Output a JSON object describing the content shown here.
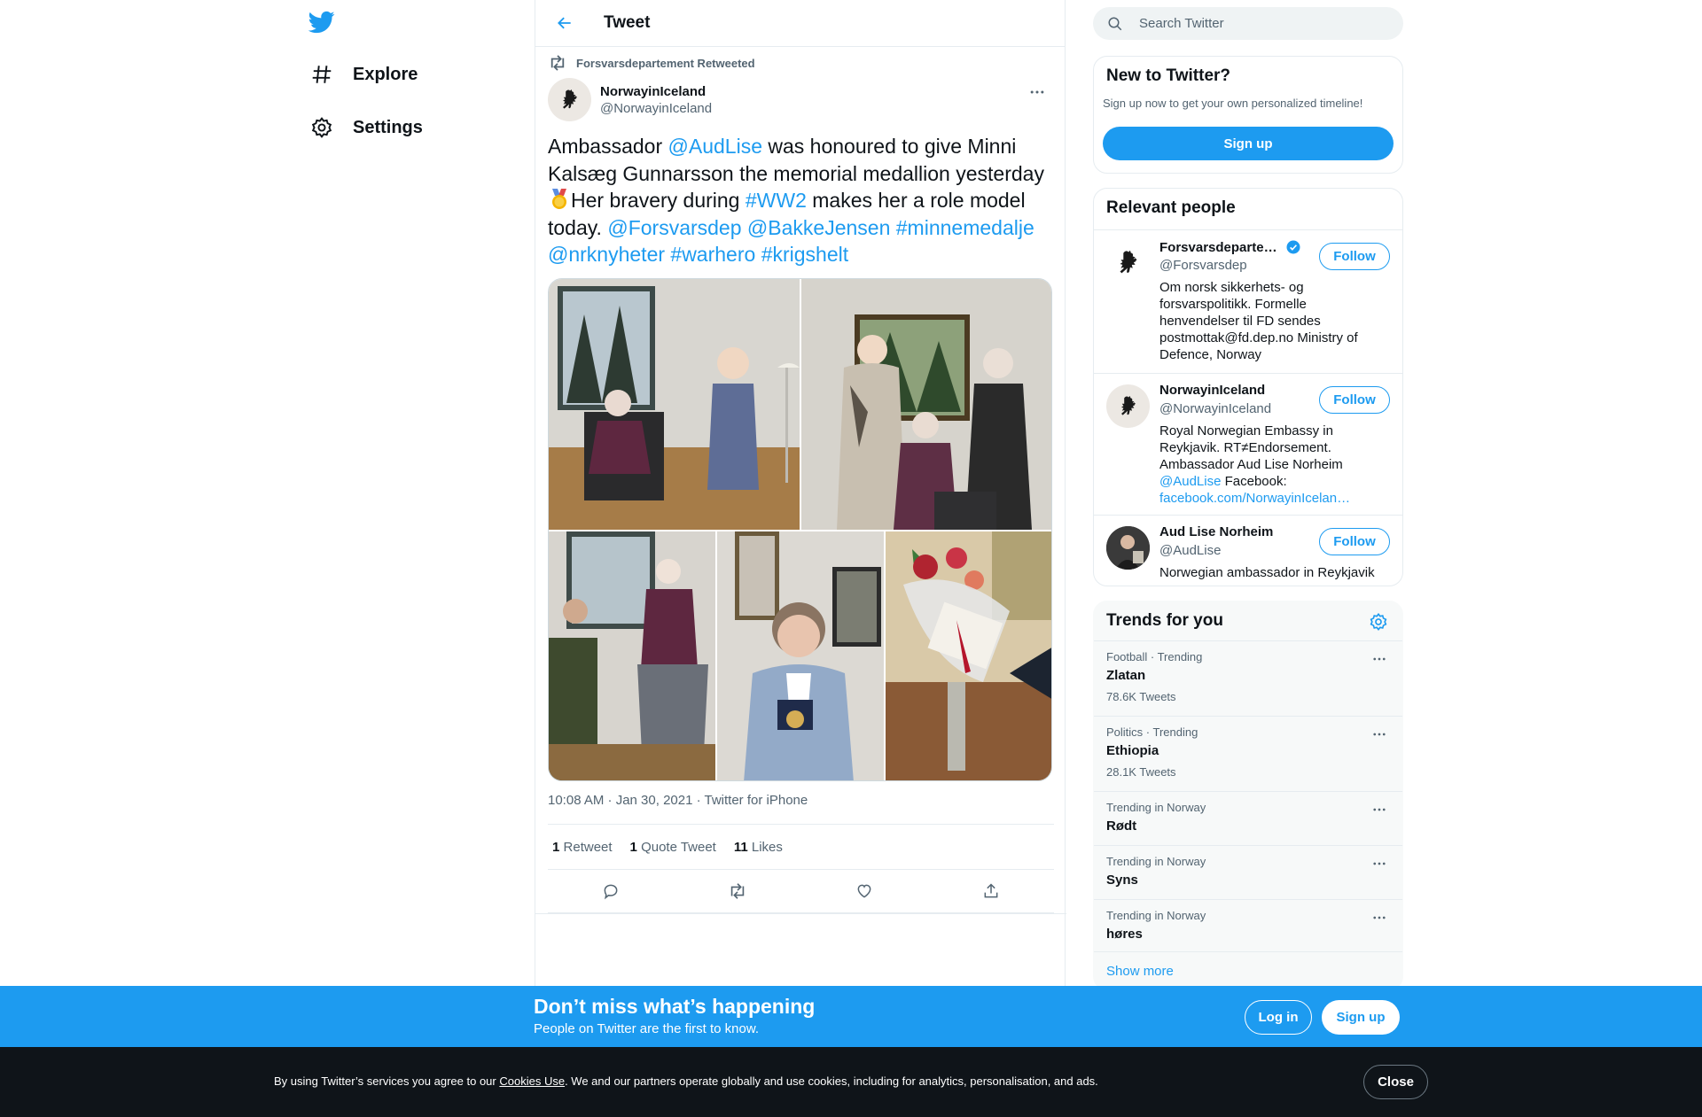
{
  "nav": {
    "logo_icon": "twitter-bird-icon",
    "items": [
      {
        "label": "Explore",
        "icon": "hashtag-icon"
      },
      {
        "label": "Settings",
        "icon": "gear-icon"
      }
    ]
  },
  "header": {
    "title": "Tweet",
    "back_icon": "arrow-left-icon"
  },
  "tweet": {
    "retweet_context": "Forsvarsdepartement Retweeted",
    "author_name": "NorwayinIceland",
    "author_handle": "@NorwayinIceland",
    "text_segments": [
      {
        "text": "Ambassador ",
        "link": false
      },
      {
        "text": "@AudLise",
        "link": true
      },
      {
        "text": " was honoured to give Minni Kalsæg Gunnarsson the memorial medallion yesterday ",
        "link": false
      },
      {
        "text": "Her bravery during ",
        "link": false
      },
      {
        "text": "#WW2",
        "link": true
      },
      {
        "text": " makes her a role model today.  ",
        "link": false
      },
      {
        "text": "@Forsvarsdep",
        "link": true
      },
      {
        "text": " ",
        "link": false
      },
      {
        "text": "@BakkeJensen",
        "link": true
      },
      {
        "text": " ",
        "link": false
      },
      {
        "text": "#minnemedalje",
        "link": true
      },
      {
        "text": " ",
        "link": false
      },
      {
        "text": "@nrknyheter",
        "link": true
      },
      {
        "text": " ",
        "link": false
      },
      {
        "text": "#warhero",
        "link": true
      },
      {
        "text": " ",
        "link": false
      },
      {
        "text": "#krigshelt",
        "link": true
      }
    ],
    "photos": [
      "photo-1",
      "photo-2",
      "photo-3",
      "photo-4",
      "photo-5"
    ],
    "time": "10:08 AM · Jan 30, 2021 · Twitter for iPhone",
    "stats": [
      {
        "count": "1",
        "label": "Retweet"
      },
      {
        "count": "1",
        "label": "Quote Tweet"
      },
      {
        "count": "11",
        "label": "Likes"
      }
    ]
  },
  "sidebar": {
    "search_placeholder": "Search Twitter",
    "new_card": {
      "title": "New to Twitter?",
      "subtitle": "Sign up now to get your own personalized timeline!",
      "signup_label": "Sign up"
    },
    "relevant": {
      "title": "Relevant people",
      "follow_label": "Follow",
      "people": [
        {
          "name": "Forsvarsdepartem…",
          "handle": "@Forsvarsdep",
          "verified": true,
          "bio": "Om norsk sikkerhets- og forsvarspolitikk. Formelle henvendelser til FD sendes postmottak@fd.dep.no Ministry of Defence, Norway"
        },
        {
          "name": "NorwayinIceland",
          "handle": "@NorwayinIceland",
          "verified": false,
          "bio_plain": "Royal Norwegian Embassy in Reykjavik. RT≠Endorsement. Ambassador Aud Lise Norheim ",
          "bio_link1": "@AudLise",
          "bio_mid": " Facebook: ",
          "bio_link2": "facebook.com/NorwayinIcelan…"
        },
        {
          "name": "Aud Lise Norheim",
          "handle": "@AudLise",
          "verified": false,
          "bio": "Norwegian ambassador in Reykjavik"
        }
      ]
    },
    "trends": {
      "title": "Trends for you",
      "items": [
        {
          "meta": "Football · Trending",
          "name": "Zlatan",
          "count": "78.6K Tweets"
        },
        {
          "meta": "Politics · Trending",
          "name": "Ethiopia",
          "count": "28.1K Tweets"
        },
        {
          "meta": "Trending in Norway",
          "name": "Rødt",
          "count": ""
        },
        {
          "meta": "Trending in Norway",
          "name": "Syns",
          "count": ""
        },
        {
          "meta": "Trending in Norway",
          "name": "høres",
          "count": ""
        }
      ],
      "show_more": "Show more"
    }
  },
  "banner": {
    "title": "Don’t miss what’s happening",
    "subtitle": "People on Twitter are the first to know.",
    "login_label": "Log in",
    "signup_label": "Sign up"
  },
  "cookie": {
    "prefix": "By using Twitter’s services you agree to our ",
    "link": "Cookies Use",
    "suffix": ". We and our partners operate globally and use cookies, including for analytics, personalisation, and ads.",
    "close_label": "Close"
  },
  "colors": {
    "accent": "#1d9bf0",
    "text": "#0f1419",
    "muted": "#536471"
  }
}
